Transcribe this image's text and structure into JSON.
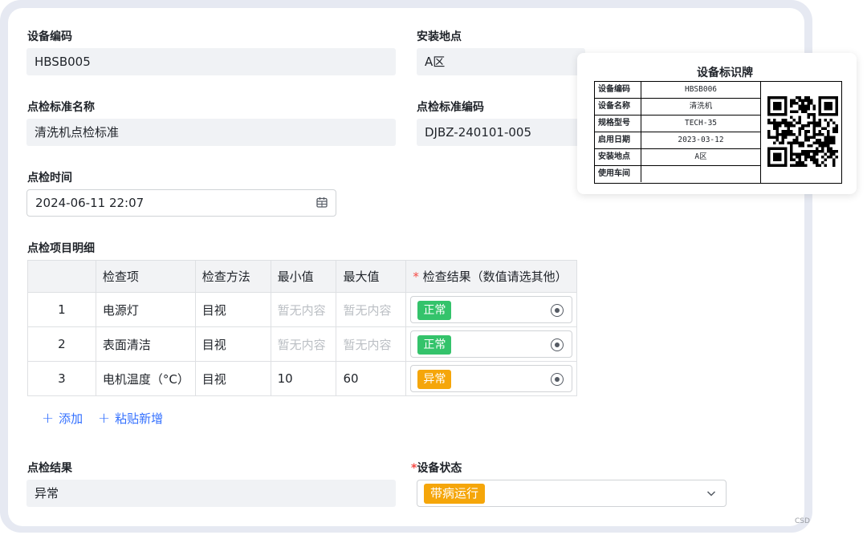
{
  "form": {
    "device_code": {
      "label": "设备编码",
      "value": "HBSB005"
    },
    "install_location": {
      "label": "安装地点",
      "value": "A区"
    },
    "standard_name": {
      "label": "点检标准名称",
      "value": "清洗机点检标准"
    },
    "standard_code": {
      "label": "点检标准编码",
      "value": "DJBZ-240101-005"
    },
    "inspection_time": {
      "label": "点检时间",
      "value": "2024-06-11 22:07"
    },
    "detail_title": "点检项目明细",
    "inspection_result": {
      "label": "点检结果",
      "value": "异常"
    },
    "device_status": {
      "required_mark": "*",
      "label": "设备状态",
      "value": "带病运行",
      "color": "#f5a60a"
    }
  },
  "detail_table": {
    "headers": {
      "index": "",
      "item": "检查项",
      "method": "检查方法",
      "min": "最小值",
      "max": "最大值",
      "result_required": "*",
      "result": "检查结果（数值请选其他）"
    },
    "rows": [
      {
        "index": "1",
        "item": "电源灯",
        "method": "目视",
        "min": "暂无内容",
        "max": "暂无内容",
        "result": "正常",
        "result_color": "#34c36b"
      },
      {
        "index": "2",
        "item": "表面清洁",
        "method": "目视",
        "min": "暂无内容",
        "max": "暂无内容",
        "result": "正常",
        "result_color": "#34c36b"
      },
      {
        "index": "3",
        "item": "电机温度（°C）",
        "method": "目视",
        "min": "10",
        "max": "60",
        "result": "异常",
        "result_color": "#f5a60a"
      }
    ],
    "add_label": "添加",
    "paste_add_label": "粘贴新增"
  },
  "nameplate": {
    "title": "设备标识牌",
    "rows": [
      {
        "key": "设备编码",
        "value": "HBSB006"
      },
      {
        "key": "设备名称",
        "value": "清洗机"
      },
      {
        "key": "规格型号",
        "value": "TECH-35"
      },
      {
        "key": "启用日期",
        "value": "2023-03-12"
      },
      {
        "key": "安装地点",
        "value": "A区"
      },
      {
        "key": "使用车间",
        "value": ""
      }
    ],
    "qr_icon": "qr-code-icon"
  },
  "watermark": "CSD",
  "colors": {
    "accent": "#3370ff",
    "normal": "#34c36b",
    "abnormal": "#f5a60a"
  }
}
